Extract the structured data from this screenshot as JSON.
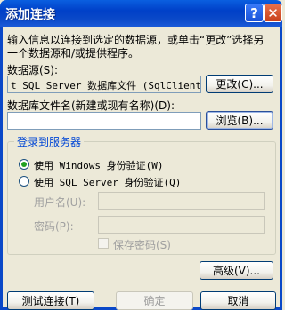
{
  "window": {
    "title": "添加连接",
    "help_glyph": "?",
    "close_glyph": "✕"
  },
  "description": "输入信息以连接到选定的数据源，或单击“更改”选择另一个数据源和/或提供程序。",
  "datasource": {
    "label": "数据源(S):",
    "value": "t SQL Server 数据库文件 (SqlClient)",
    "change_button": "更改(C)..."
  },
  "dbfile": {
    "label": "数据库文件名(新建或现有名称)(D):",
    "value": "",
    "browse_button": "浏览(B)..."
  },
  "login": {
    "group_label": "登录到服务器",
    "windows_auth": "使用 Windows 身份验证(W)",
    "sql_auth": "使用 SQL Server 身份验证(Q)",
    "selected": "windows",
    "username_label": "用户名(U):",
    "password_label": "密码(P):",
    "save_password_label": "保存密码(S)",
    "username_value": "",
    "password_value": ""
  },
  "buttons": {
    "advanced": "高级(V)...",
    "test": "测试连接(T)",
    "ok": "确定",
    "cancel": "取消"
  }
}
